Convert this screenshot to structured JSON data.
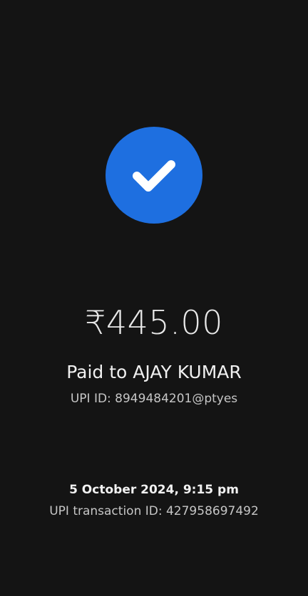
{
  "status": {
    "icon": "check-icon",
    "accent_color": "#1e6fe0"
  },
  "payment": {
    "amount": "₹445.00",
    "paid_to": "Paid to AJAY KUMAR",
    "upi_id": "UPI ID: 8949484201@ptyes"
  },
  "transaction": {
    "datetime": "5 October 2024, 9:15 pm",
    "transaction_id": "UPI transaction ID: 427958697492"
  }
}
